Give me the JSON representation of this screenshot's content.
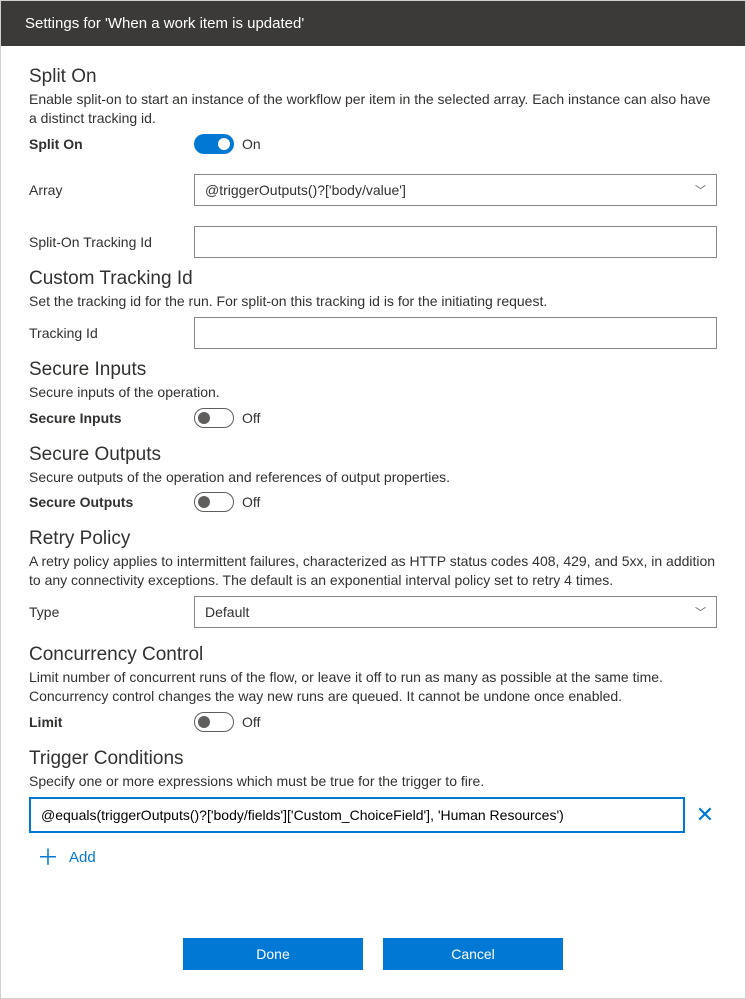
{
  "header": {
    "title": "Settings for 'When a work item is updated'"
  },
  "splitOn": {
    "title": "Split On",
    "desc": "Enable split-on to start an instance of the workflow per item in the selected array. Each instance can also have a distinct tracking id.",
    "toggleLabel": "Split On",
    "toggleState": "On",
    "arrayLabel": "Array",
    "arrayValue": "@triggerOutputs()?['body/value']",
    "trackingLabel": "Split-On Tracking Id",
    "trackingValue": ""
  },
  "customTracking": {
    "title": "Custom Tracking Id",
    "desc": "Set the tracking id for the run. For split-on this tracking id is for the initiating request.",
    "label": "Tracking Id",
    "value": ""
  },
  "secureInputs": {
    "title": "Secure Inputs",
    "desc": "Secure inputs of the operation.",
    "toggleLabel": "Secure Inputs",
    "toggleState": "Off"
  },
  "secureOutputs": {
    "title": "Secure Outputs",
    "desc": "Secure outputs of the operation and references of output properties.",
    "toggleLabel": "Secure Outputs",
    "toggleState": "Off"
  },
  "retryPolicy": {
    "title": "Retry Policy",
    "desc": "A retry policy applies to intermittent failures, characterized as HTTP status codes 408, 429, and 5xx, in addition to any connectivity exceptions. The default is an exponential interval policy set to retry 4 times.",
    "typeLabel": "Type",
    "typeValue": "Default"
  },
  "concurrency": {
    "title": "Concurrency Control",
    "desc": "Limit number of concurrent runs of the flow, or leave it off to run as many as possible at the same time. Concurrency control changes the way new runs are queued. It cannot be undone once enabled.",
    "toggleLabel": "Limit",
    "toggleState": "Off"
  },
  "triggerConditions": {
    "title": "Trigger Conditions",
    "desc": "Specify one or more expressions which must be true for the trigger to fire.",
    "conditionValue": "@equals(triggerOutputs()?['body/fields']['Custom_ChoiceField'], 'Human Resources')",
    "addLabel": "Add"
  },
  "footer": {
    "done": "Done",
    "cancel": "Cancel"
  }
}
